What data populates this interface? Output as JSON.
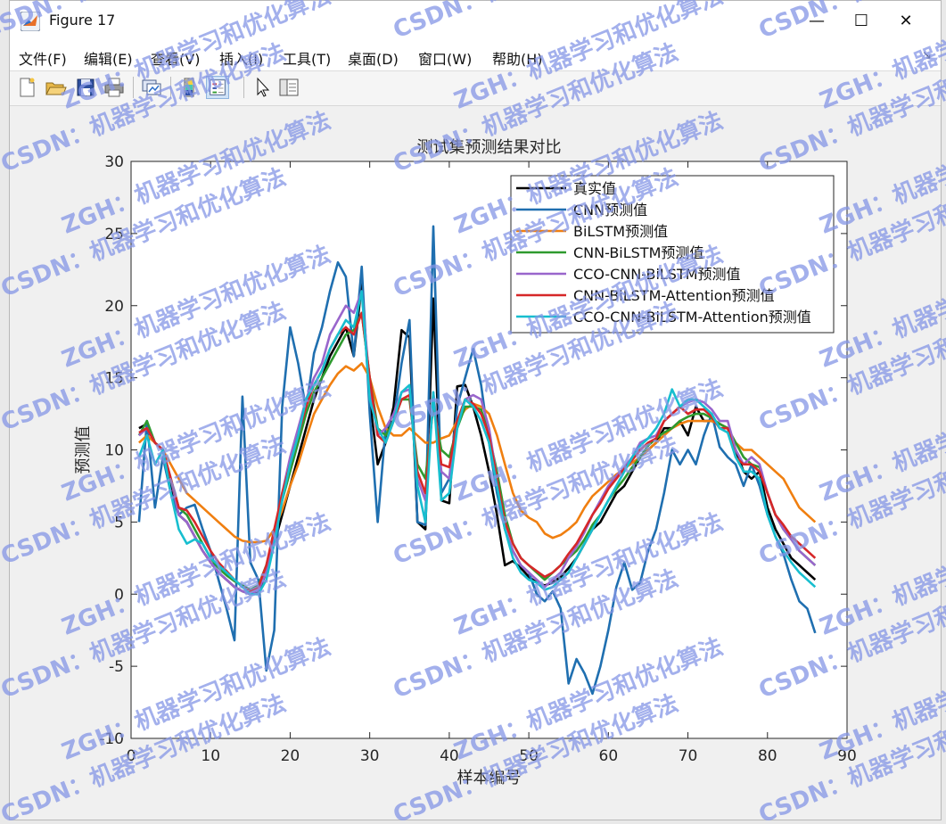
{
  "window": {
    "title": "Figure 17",
    "minimize_glyph": "—",
    "maximize_glyph": "☐",
    "close_glyph": "✕"
  },
  "menu": [
    "文件(F)",
    "编辑(E)",
    "查看(V)",
    "插入(I)",
    "工具(T)",
    "桌面(D)",
    "窗口(W)",
    "帮助(H)"
  ],
  "toolbar_icons": [
    "new-file-icon",
    "open-folder-icon",
    "save-icon",
    "print-icon",
    "link-plot-icon",
    "colorbar-icon",
    "legend-icon",
    "pointer-icon",
    "property-editor-icon"
  ],
  "watermark": {
    "line1": "ZGH：机器学习和优化算法",
    "line2": "CSDN：机器学习和优化算法",
    "color": "#8596e6"
  },
  "chart_data": {
    "type": "line",
    "title": "测试集预测结果对比",
    "xlabel": "样本编号",
    "ylabel": "预测值",
    "xlim": [
      0,
      90
    ],
    "ylim": [
      -10,
      30
    ],
    "xticks": [
      0,
      10,
      20,
      30,
      40,
      50,
      60,
      70,
      80,
      90
    ],
    "yticks": [
      -10,
      -5,
      0,
      5,
      10,
      15,
      20,
      25,
      30
    ],
    "grid": false,
    "legend_position": "top-right",
    "series": [
      {
        "name": "真实值",
        "color": "#000000",
        "width": 2.6,
        "x": [
          1,
          2,
          3,
          4,
          5,
          6,
          7,
          8,
          9,
          10,
          11,
          12,
          13,
          14,
          15,
          16,
          17,
          18,
          19,
          20,
          21,
          22,
          23,
          24,
          25,
          26,
          27,
          28,
          29,
          30,
          31,
          32,
          33,
          34,
          35,
          36,
          37,
          38,
          39,
          40,
          41,
          42,
          43,
          44,
          45,
          46,
          47,
          48,
          49,
          50,
          51,
          52,
          53,
          54,
          55,
          56,
          57,
          58,
          59,
          60,
          61,
          62,
          63,
          64,
          65,
          66,
          67,
          68,
          69,
          70,
          71,
          72,
          73,
          74,
          75,
          76,
          77,
          78,
          79,
          80,
          81,
          82,
          83,
          84,
          85,
          86
        ],
        "y": [
          11.5,
          11.8,
          10.5,
          10.0,
          7.5,
          5.5,
          5.0,
          4.0,
          3.0,
          2.2,
          1.5,
          1.0,
          0.5,
          0.2,
          0.0,
          0.2,
          1.5,
          3.5,
          5.5,
          7.5,
          9.5,
          11.5,
          13.5,
          15.0,
          16.5,
          17.5,
          18.5,
          16.5,
          21.5,
          13.5,
          9.0,
          10.5,
          13.0,
          18.3,
          17.8,
          5.0,
          4.5,
          20.5,
          6.5,
          6.3,
          14.4,
          14.5,
          13.0,
          11.0,
          8.5,
          5.5,
          2.0,
          2.3,
          1.8,
          1.2,
          0.8,
          0.6,
          0.8,
          1.2,
          1.8,
          2.5,
          3.5,
          4.5,
          5.0,
          6.0,
          7.0,
          7.5,
          8.5,
          9.5,
          10.0,
          10.5,
          11.5,
          11.5,
          12.0,
          11.0,
          13.0,
          12.0,
          12.0,
          11.8,
          11.5,
          10.0,
          8.5,
          8.0,
          8.5,
          6.0,
          4.5,
          3.5,
          2.5,
          2.0,
          1.5,
          1.0
        ]
      },
      {
        "name": "CNN预测值",
        "color": "#1f6fb0",
        "width": 2.6,
        "x": [
          1,
          2,
          3,
          4,
          5,
          6,
          7,
          8,
          9,
          10,
          11,
          12,
          13,
          14,
          15,
          16,
          17,
          18,
          19,
          20,
          21,
          22,
          23,
          24,
          25,
          26,
          27,
          28,
          29,
          30,
          31,
          32,
          33,
          34,
          35,
          36,
          37,
          38,
          39,
          40,
          41,
          42,
          43,
          44,
          45,
          46,
          47,
          48,
          49,
          50,
          51,
          52,
          53,
          54,
          55,
          56,
          57,
          58,
          59,
          60,
          61,
          62,
          63,
          64,
          65,
          66,
          67,
          68,
          69,
          70,
          71,
          72,
          73,
          74,
          75,
          76,
          77,
          78,
          79,
          80,
          81,
          82,
          83,
          84,
          85,
          86
        ],
        "y": [
          5.0,
          12.0,
          6.0,
          9.5,
          7.0,
          5.5,
          6.0,
          6.2,
          4.5,
          3.0,
          1.0,
          -1.0,
          -3.2,
          13.7,
          2.2,
          1.0,
          -5.3,
          -2.5,
          13.0,
          18.5,
          16.0,
          12.8,
          16.7,
          18.5,
          21.0,
          23.0,
          22.0,
          16.5,
          22.7,
          12.5,
          5.0,
          11.5,
          12.0,
          16.0,
          19.0,
          5.0,
          4.8,
          25.5,
          7.0,
          8.0,
          13.0,
          15.0,
          17.0,
          14.5,
          10.5,
          7.0,
          4.5,
          3.0,
          2.0,
          1.5,
          0.0,
          -0.5,
          0.2,
          -1.0,
          -6.2,
          -4.5,
          -5.5,
          -6.9,
          -5.0,
          -2.5,
          0.5,
          2.2,
          0.3,
          0.8,
          3.0,
          4.5,
          7.0,
          10.0,
          9.0,
          10.0,
          9.0,
          11.0,
          12.5,
          10.2,
          9.5,
          9.0,
          7.5,
          9.0,
          7.5,
          5.5,
          4.0,
          2.8,
          1.0,
          -0.5,
          -1.0,
          -2.7
        ]
      },
      {
        "name": "BiLSTM预测值",
        "color": "#f07f10",
        "width": 2.6,
        "x": [
          1,
          2,
          3,
          4,
          5,
          6,
          7,
          8,
          9,
          10,
          11,
          12,
          13,
          14,
          15,
          16,
          17,
          18,
          19,
          20,
          21,
          22,
          23,
          24,
          25,
          26,
          27,
          28,
          29,
          30,
          31,
          32,
          33,
          34,
          35,
          36,
          37,
          38,
          39,
          40,
          41,
          42,
          43,
          44,
          45,
          46,
          47,
          48,
          49,
          50,
          51,
          52,
          53,
          54,
          55,
          56,
          57,
          58,
          59,
          60,
          61,
          62,
          63,
          64,
          65,
          66,
          67,
          68,
          69,
          70,
          71,
          72,
          73,
          74,
          75,
          76,
          77,
          78,
          79,
          80,
          81,
          82,
          83,
          84,
          85,
          86
        ],
        "y": [
          10.5,
          11.0,
          10.5,
          10.0,
          9.0,
          8.0,
          7.0,
          6.5,
          6.0,
          5.5,
          5.0,
          4.5,
          4.0,
          3.7,
          3.6,
          3.6,
          3.7,
          4.5,
          5.8,
          7.5,
          9.0,
          10.8,
          12.5,
          13.5,
          14.5,
          15.3,
          15.8,
          15.5,
          16.0,
          15.0,
          13.0,
          11.5,
          11.0,
          11.0,
          11.5,
          11.0,
          10.5,
          10.5,
          10.8,
          11.0,
          12.0,
          12.8,
          13.2,
          13.0,
          12.5,
          11.0,
          9.0,
          7.0,
          5.8,
          5.3,
          5.0,
          4.2,
          3.9,
          4.1,
          4.5,
          5.0,
          6.0,
          6.8,
          7.3,
          7.8,
          8.3,
          8.7,
          9.1,
          9.5,
          10.0,
          10.5,
          11.0,
          11.5,
          11.8,
          12.0,
          12.0,
          12.0,
          12.0,
          11.8,
          11.5,
          10.5,
          10.0,
          10.0,
          9.5,
          9.0,
          8.5,
          8.0,
          7.0,
          6.0,
          5.5,
          5.0
        ]
      },
      {
        "name": "CNN-BiLSTM预测值",
        "color": "#2e9a2e",
        "width": 2.6,
        "x": [
          1,
          2,
          3,
          4,
          5,
          6,
          7,
          8,
          9,
          10,
          11,
          12,
          13,
          14,
          15,
          16,
          17,
          18,
          19,
          20,
          21,
          22,
          23,
          24,
          25,
          26,
          27,
          28,
          29,
          30,
          31,
          32,
          33,
          34,
          35,
          36,
          37,
          38,
          39,
          40,
          41,
          42,
          43,
          44,
          45,
          46,
          47,
          48,
          49,
          50,
          51,
          52,
          53,
          54,
          55,
          56,
          57,
          58,
          59,
          60,
          61,
          62,
          63,
          64,
          65,
          66,
          67,
          68,
          69,
          70,
          71,
          72,
          73,
          74,
          75,
          76,
          77,
          78,
          79,
          80,
          81,
          82,
          83,
          84,
          85,
          86
        ],
        "y": [
          11.0,
          12.0,
          10.5,
          10.0,
          8.0,
          6.0,
          5.5,
          4.5,
          3.5,
          2.5,
          1.8,
          1.3,
          0.9,
          0.6,
          0.3,
          0.6,
          2.0,
          4.0,
          6.5,
          8.5,
          10.5,
          12.5,
          14.0,
          15.0,
          16.0,
          17.0,
          18.0,
          18.3,
          19.5,
          15.0,
          11.5,
          11.0,
          12.0,
          13.5,
          13.5,
          9.0,
          8.0,
          13.0,
          10.0,
          9.5,
          11.5,
          13.0,
          13.0,
          12.8,
          11.0,
          8.5,
          5.5,
          3.5,
          2.5,
          2.0,
          1.5,
          1.0,
          1.5,
          2.0,
          2.5,
          3.0,
          3.8,
          4.8,
          5.5,
          6.5,
          7.3,
          8.0,
          8.8,
          9.5,
          10.3,
          10.8,
          11.2,
          11.5,
          12.0,
          12.3,
          12.5,
          12.5,
          12.2,
          11.8,
          11.5,
          10.5,
          9.5,
          9.0,
          8.8,
          7.0,
          5.5,
          4.5,
          3.8,
          3.0,
          2.5,
          2.0
        ]
      },
      {
        "name": "CCO-CNN-BiLSTM预测值",
        "color": "#9966cc",
        "width": 2.6,
        "x": [
          1,
          2,
          3,
          4,
          5,
          6,
          7,
          8,
          9,
          10,
          11,
          12,
          13,
          14,
          15,
          16,
          17,
          18,
          19,
          20,
          21,
          22,
          23,
          24,
          25,
          26,
          27,
          28,
          29,
          30,
          31,
          32,
          33,
          34,
          35,
          36,
          37,
          38,
          39,
          40,
          41,
          42,
          43,
          44,
          45,
          46,
          47,
          48,
          49,
          50,
          51,
          52,
          53,
          54,
          55,
          56,
          57,
          58,
          59,
          60,
          61,
          62,
          63,
          64,
          65,
          66,
          67,
          68,
          69,
          70,
          71,
          72,
          73,
          74,
          75,
          76,
          77,
          78,
          79,
          80,
          81,
          82,
          83,
          84,
          85,
          86
        ],
        "y": [
          11.0,
          11.5,
          10.5,
          10.0,
          8.0,
          5.5,
          5.0,
          4.0,
          3.0,
          2.2,
          1.5,
          1.0,
          0.5,
          0.2,
          0.0,
          0.3,
          1.5,
          4.0,
          7.0,
          9.5,
          11.5,
          13.5,
          15.0,
          16.0,
          18.0,
          19.0,
          20.0,
          19.5,
          21.0,
          14.5,
          11.0,
          11.5,
          12.5,
          14.0,
          14.2,
          8.0,
          6.5,
          14.0,
          8.5,
          8.0,
          12.0,
          13.5,
          13.8,
          13.5,
          11.5,
          8.0,
          4.5,
          3.0,
          2.0,
          1.5,
          1.0,
          0.5,
          1.0,
          1.5,
          2.5,
          3.3,
          4.3,
          5.5,
          6.5,
          7.5,
          8.2,
          8.8,
          9.5,
          10.5,
          10.8,
          11.0,
          12.0,
          12.5,
          13.0,
          13.3,
          13.5,
          13.3,
          12.8,
          12.0,
          12.0,
          10.0,
          9.0,
          9.5,
          9.0,
          7.0,
          5.5,
          4.5,
          3.8,
          3.0,
          2.5,
          2.0
        ]
      },
      {
        "name": "CNN-BiLSTM-Attention预测值",
        "color": "#d62728",
        "width": 2.6,
        "x": [
          1,
          2,
          3,
          4,
          5,
          6,
          7,
          8,
          9,
          10,
          11,
          12,
          13,
          14,
          15,
          16,
          17,
          18,
          19,
          20,
          21,
          22,
          23,
          24,
          25,
          26,
          27,
          28,
          29,
          30,
          31,
          32,
          33,
          34,
          35,
          36,
          37,
          38,
          39,
          40,
          41,
          42,
          43,
          44,
          45,
          46,
          47,
          48,
          49,
          50,
          51,
          52,
          53,
          54,
          55,
          56,
          57,
          58,
          59,
          60,
          61,
          62,
          63,
          64,
          65,
          66,
          67,
          68,
          69,
          70,
          71,
          72,
          73,
          74,
          75,
          76,
          77,
          78,
          79,
          80,
          81,
          82,
          83,
          84,
          85,
          86
        ],
        "y": [
          11.2,
          11.5,
          10.5,
          10.0,
          8.0,
          6.0,
          5.8,
          5.0,
          4.0,
          3.0,
          2.2,
          1.6,
          1.0,
          0.5,
          0.2,
          0.5,
          2.0,
          4.5,
          7.0,
          9.0,
          11.0,
          13.0,
          14.5,
          15.5,
          17.0,
          18.0,
          18.5,
          18.0,
          19.5,
          15.0,
          11.0,
          10.5,
          12.0,
          13.5,
          13.8,
          8.5,
          7.0,
          13.5,
          9.0,
          8.8,
          12.0,
          13.5,
          13.2,
          12.5,
          11.0,
          8.0,
          5.0,
          3.5,
          2.5,
          2.0,
          1.6,
          1.2,
          1.5,
          2.0,
          2.8,
          3.5,
          4.5,
          5.5,
          6.3,
          7.3,
          8.0,
          8.7,
          9.3,
          10.0,
          10.5,
          10.8,
          12.0,
          12.5,
          13.0,
          12.5,
          12.8,
          12.8,
          12.3,
          11.5,
          11.5,
          9.5,
          9.0,
          9.0,
          8.5,
          7.0,
          5.5,
          4.8,
          4.0,
          3.5,
          3.0,
          2.5
        ]
      },
      {
        "name": "CCO-CNN-BiLSTM-Attention预测值",
        "color": "#17becf",
        "width": 2.6,
        "x": [
          1,
          2,
          3,
          4,
          5,
          6,
          7,
          8,
          9,
          10,
          11,
          12,
          13,
          14,
          15,
          16,
          17,
          18,
          19,
          20,
          21,
          22,
          23,
          24,
          25,
          26,
          27,
          28,
          29,
          30,
          31,
          32,
          33,
          34,
          35,
          36,
          37,
          38,
          39,
          40,
          41,
          42,
          43,
          44,
          45,
          46,
          47,
          48,
          49,
          50,
          51,
          52,
          53,
          54,
          55,
          56,
          57,
          58,
          59,
          60,
          61,
          62,
          63,
          64,
          65,
          66,
          67,
          68,
          69,
          70,
          71,
          72,
          73,
          74,
          75,
          76,
          77,
          78,
          79,
          80,
          81,
          82,
          83,
          84,
          85,
          86
        ],
        "y": [
          9.5,
          11.0,
          9.0,
          10.0,
          7.0,
          4.5,
          3.5,
          3.8,
          3.5,
          2.5,
          2.0,
          1.5,
          1.0,
          0.5,
          0.0,
          0.0,
          1.0,
          3.5,
          6.5,
          9.0,
          11.0,
          13.5,
          14.5,
          15.5,
          17.0,
          18.0,
          19.0,
          18.5,
          21.0,
          13.5,
          11.5,
          10.5,
          12.0,
          14.0,
          14.5,
          7.5,
          5.0,
          14.0,
          6.5,
          7.0,
          11.5,
          13.5,
          13.0,
          12.0,
          10.5,
          7.5,
          4.5,
          2.5,
          1.5,
          1.0,
          0.8,
          0.3,
          0.5,
          1.0,
          1.5,
          2.5,
          3.5,
          4.5,
          5.5,
          6.5,
          7.5,
          8.5,
          9.5,
          10.3,
          10.8,
          11.5,
          12.5,
          14.2,
          13.0,
          13.5,
          13.5,
          13.0,
          12.5,
          11.5,
          11.2,
          9.5,
          8.5,
          8.5,
          8.0,
          5.5,
          4.0,
          3.0,
          2.2,
          1.5,
          1.0,
          0.5
        ]
      }
    ]
  }
}
